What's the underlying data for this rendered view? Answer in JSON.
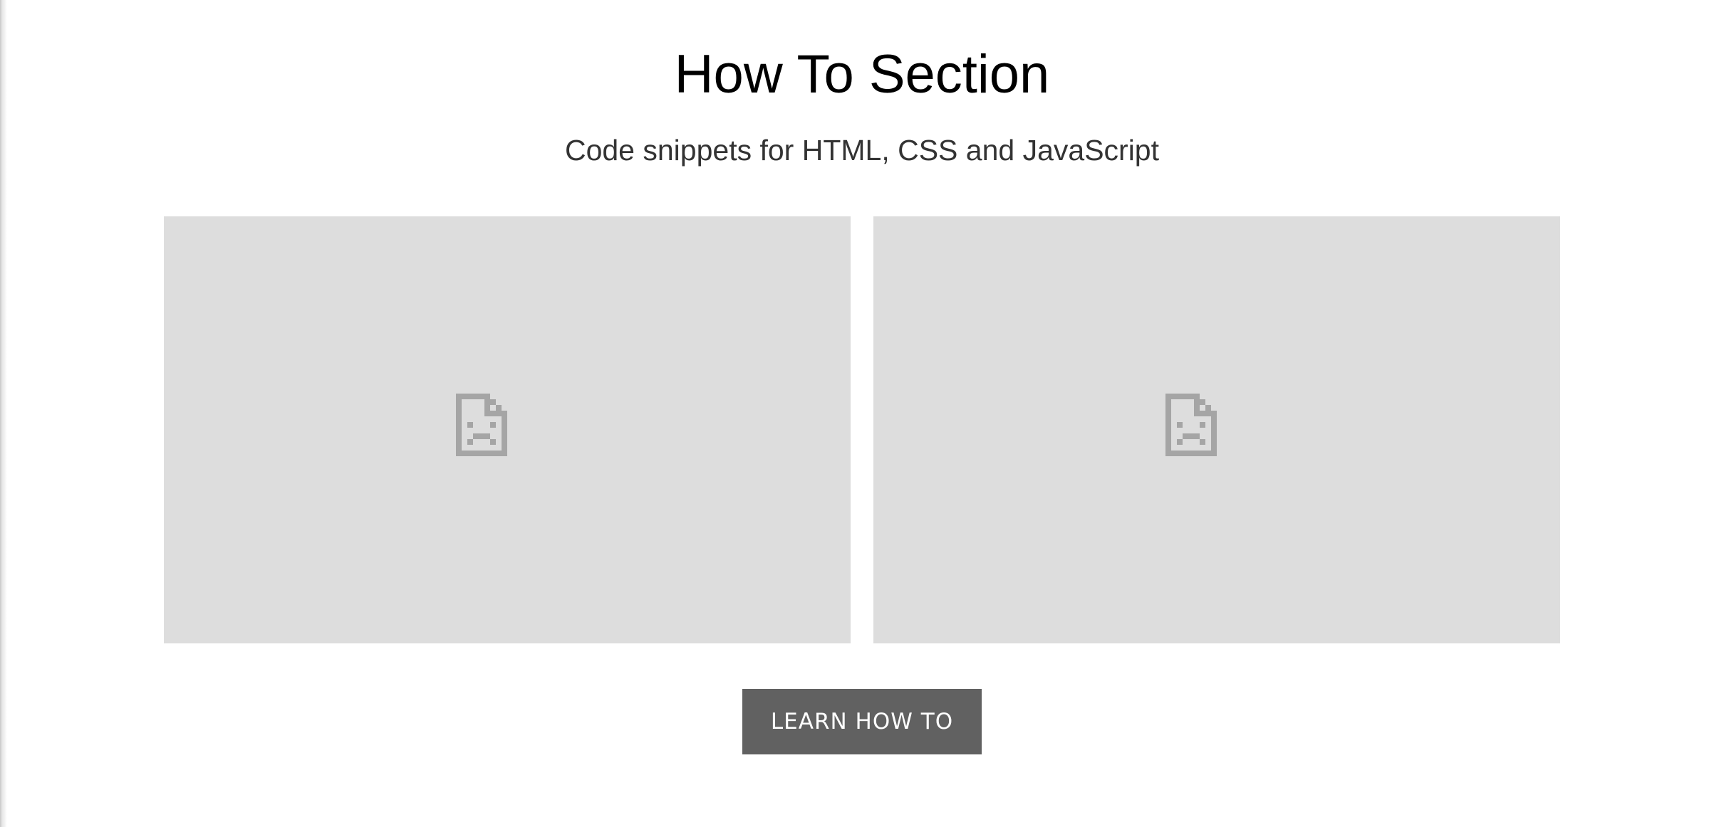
{
  "header": {
    "title": "How To Section",
    "subtitle": "Code snippets for HTML, CSS and JavaScript"
  },
  "images": [
    {
      "state": "broken",
      "icon": "broken-image-icon"
    },
    {
      "state": "broken",
      "icon": "broken-image-icon"
    }
  ],
  "cta": {
    "label": "LEARN HOW TO"
  },
  "colors": {
    "background": "#ffffff",
    "title": "#000000",
    "subtitle": "#333333",
    "image_placeholder": "#dddddd",
    "icon": "#a5a5a5",
    "button_bg": "#616161",
    "button_text": "#ffffff"
  }
}
